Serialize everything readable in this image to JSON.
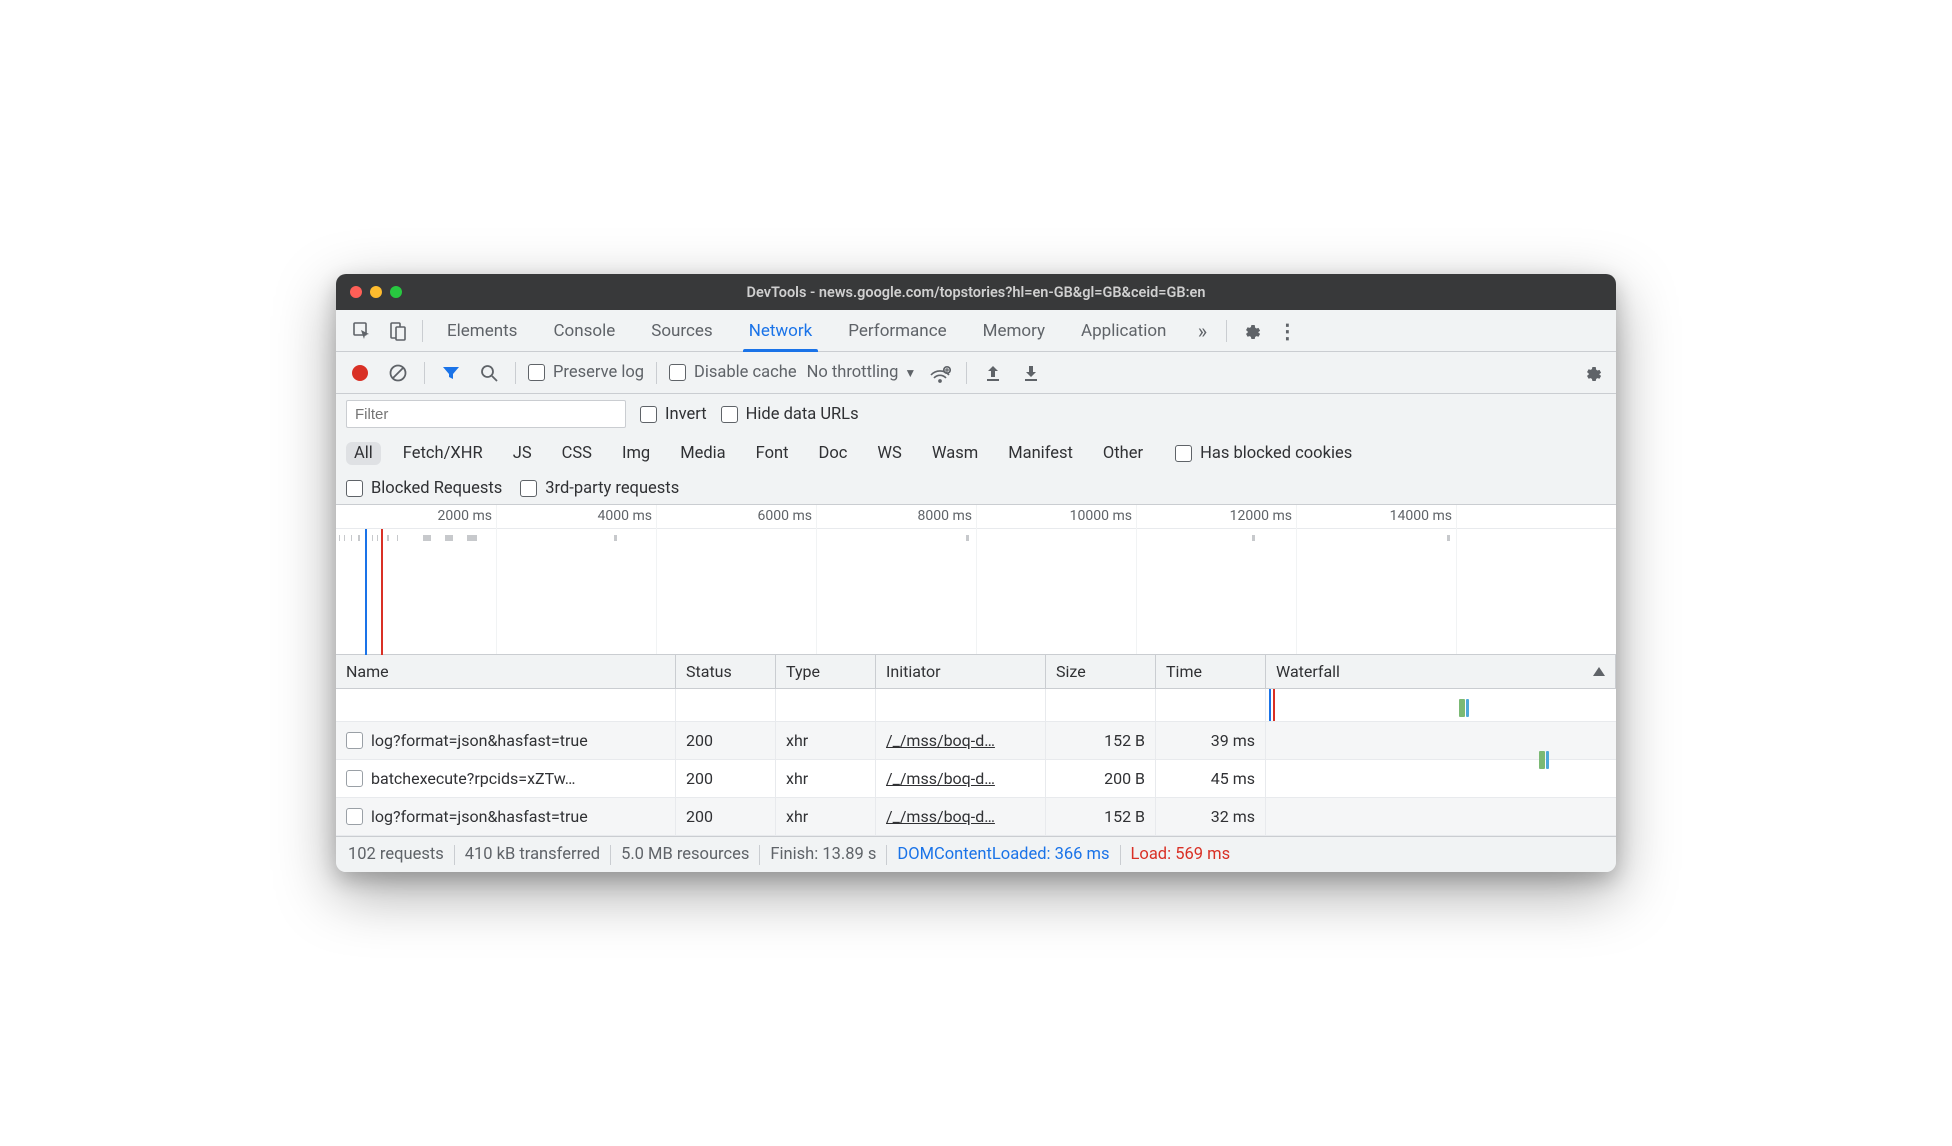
{
  "window_title": "DevTools - news.google.com/topstories?hl=en-GB&gl=GB&ceid=GB:en",
  "tabs": [
    "Elements",
    "Console",
    "Sources",
    "Network",
    "Performance",
    "Memory",
    "Application"
  ],
  "active_tab": "Network",
  "toolbar": {
    "preserve_log": "Preserve log",
    "disable_cache": "Disable cache",
    "throttling": "No throttling"
  },
  "filter": {
    "placeholder": "Filter",
    "invert": "Invert",
    "hide_data_urls": "Hide data URLs",
    "types": [
      "All",
      "Fetch/XHR",
      "JS",
      "CSS",
      "Img",
      "Media",
      "Font",
      "Doc",
      "WS",
      "Wasm",
      "Manifest",
      "Other"
    ],
    "active_type": "All",
    "has_blocked_cookies": "Has blocked cookies",
    "blocked_requests": "Blocked Requests",
    "third_party": "3rd-party requests"
  },
  "timeline_ticks": [
    "2000 ms",
    "4000 ms",
    "6000 ms",
    "8000 ms",
    "10000 ms",
    "12000 ms",
    "14000 ms"
  ],
  "columns": [
    "Name",
    "Status",
    "Type",
    "Initiator",
    "Size",
    "Time",
    "Waterfall"
  ],
  "rows": [
    {
      "name": "log?format=json&hasfast=true",
      "status": "200",
      "type": "xhr",
      "initiator": "/_/mss/boq-d…",
      "size": "152 B",
      "time": "39 ms"
    },
    {
      "name": "batchexecute?rpcids=xZTw…",
      "status": "200",
      "type": "xhr",
      "initiator": "/_/mss/boq-d…",
      "size": "200 B",
      "time": "45 ms"
    },
    {
      "name": "log?format=json&hasfast=true",
      "status": "200",
      "type": "xhr",
      "initiator": "/_/mss/boq-d…",
      "size": "152 B",
      "time": "32 ms"
    }
  ],
  "status": {
    "requests": "102 requests",
    "transferred": "410 kB transferred",
    "resources": "5.0 MB resources",
    "finish": "Finish: 13.89 s",
    "dom": "DOMContentLoaded: 366 ms",
    "load": "Load: 569 ms"
  }
}
